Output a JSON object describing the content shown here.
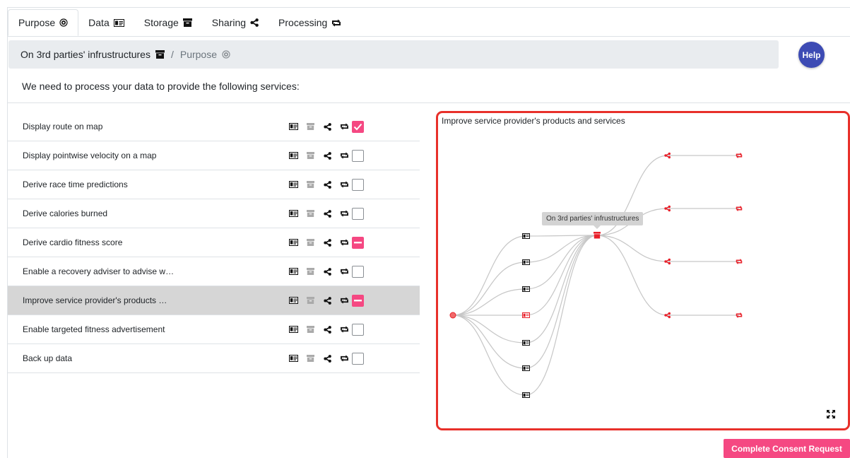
{
  "tabs": [
    {
      "label": "Purpose",
      "icon": "purpose-icon"
    },
    {
      "label": "Data",
      "icon": "data-icon"
    },
    {
      "label": "Storage",
      "icon": "storage-icon"
    },
    {
      "label": "Sharing",
      "icon": "sharing-icon"
    },
    {
      "label": "Processing",
      "icon": "processing-icon"
    }
  ],
  "breadcrumb": {
    "first": "On 3rd parties' infrustructures",
    "separator": "/",
    "second": "Purpose"
  },
  "help_label": "Help",
  "intro": "We need to process your data to provide the following services:",
  "purposes": [
    {
      "label": "Display route on map",
      "state": "checked"
    },
    {
      "label": "Display pointwise velocity on a map",
      "state": "unchecked"
    },
    {
      "label": "Derive race time predictions",
      "state": "unchecked"
    },
    {
      "label": "Derive calories burned",
      "state": "unchecked"
    },
    {
      "label": "Derive cardio fitness score",
      "state": "partial"
    },
    {
      "label": "Enable a recovery adviser to advise w…",
      "state": "unchecked"
    },
    {
      "label": "Improve service provider's products …",
      "state": "partial",
      "selected": true
    },
    {
      "label": "Enable targeted fitness advertisement",
      "state": "unchecked"
    },
    {
      "label": "Back up data",
      "state": "unchecked"
    }
  ],
  "graph": {
    "title": "Improve service provider's products and services",
    "tooltip": "On 3rd parties' infrustructures"
  },
  "complete_label": "Complete Consent Request",
  "colors": {
    "accent": "#f54882",
    "help": "#3d4bb4",
    "panel_border": "#e8302a",
    "node_red": "#e8202a"
  }
}
